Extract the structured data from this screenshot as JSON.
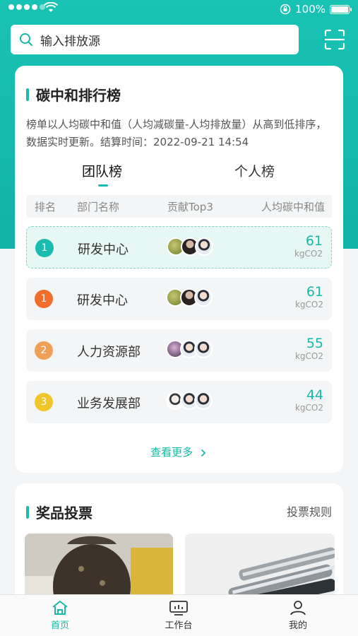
{
  "status_bar": {
    "battery": "100%",
    "wifi_icon": "wifi-icon",
    "signal_dots": 5,
    "signal_on": 4
  },
  "search": {
    "text": "输入排放源",
    "icon": "search-icon"
  },
  "leaderboard": {
    "title": "碳中和排行榜",
    "description": "榜单以人均碳中和值（人均减碳量-人均排放量）从高到低排序，数据实时更新。结算时间：2022-09-21 14:54",
    "tabs": [
      "团队榜",
      "个人榜"
    ],
    "active_tab": "团队榜",
    "columns": [
      "排名",
      "部门名称",
      "贡献Top3",
      "人均碳中和值"
    ],
    "rows": [
      {
        "rank": "1",
        "dept": "研发中心",
        "value": "61",
        "unit": "kgCO2",
        "rank_color": "#19bcae",
        "highlight": true
      },
      {
        "rank": "1",
        "dept": "研发中心",
        "value": "61",
        "unit": "kgCO2",
        "rank_color": "#f26c2b",
        "highlight": false
      },
      {
        "rank": "2",
        "dept": "人力资源部",
        "value": "55",
        "unit": "kgCO2",
        "rank_color": "#f0a056",
        "highlight": false
      },
      {
        "rank": "3",
        "dept": "业务发展部",
        "value": "44",
        "unit": "kgCO2",
        "rank_color": "#f0c72b",
        "highlight": false
      }
    ],
    "more_label": "查看更多"
  },
  "prizes": {
    "title": "奖品投票",
    "rules_label": "投票规则"
  },
  "bottom_nav": [
    {
      "label": "首页",
      "icon": "home-icon",
      "active": true
    },
    {
      "label": "工作台",
      "icon": "workbench-icon",
      "active": false
    },
    {
      "label": "我的",
      "icon": "profile-icon",
      "active": false
    }
  ],
  "colors": {
    "accent": "#17b8a7",
    "header_bg": "#19c3b3"
  }
}
